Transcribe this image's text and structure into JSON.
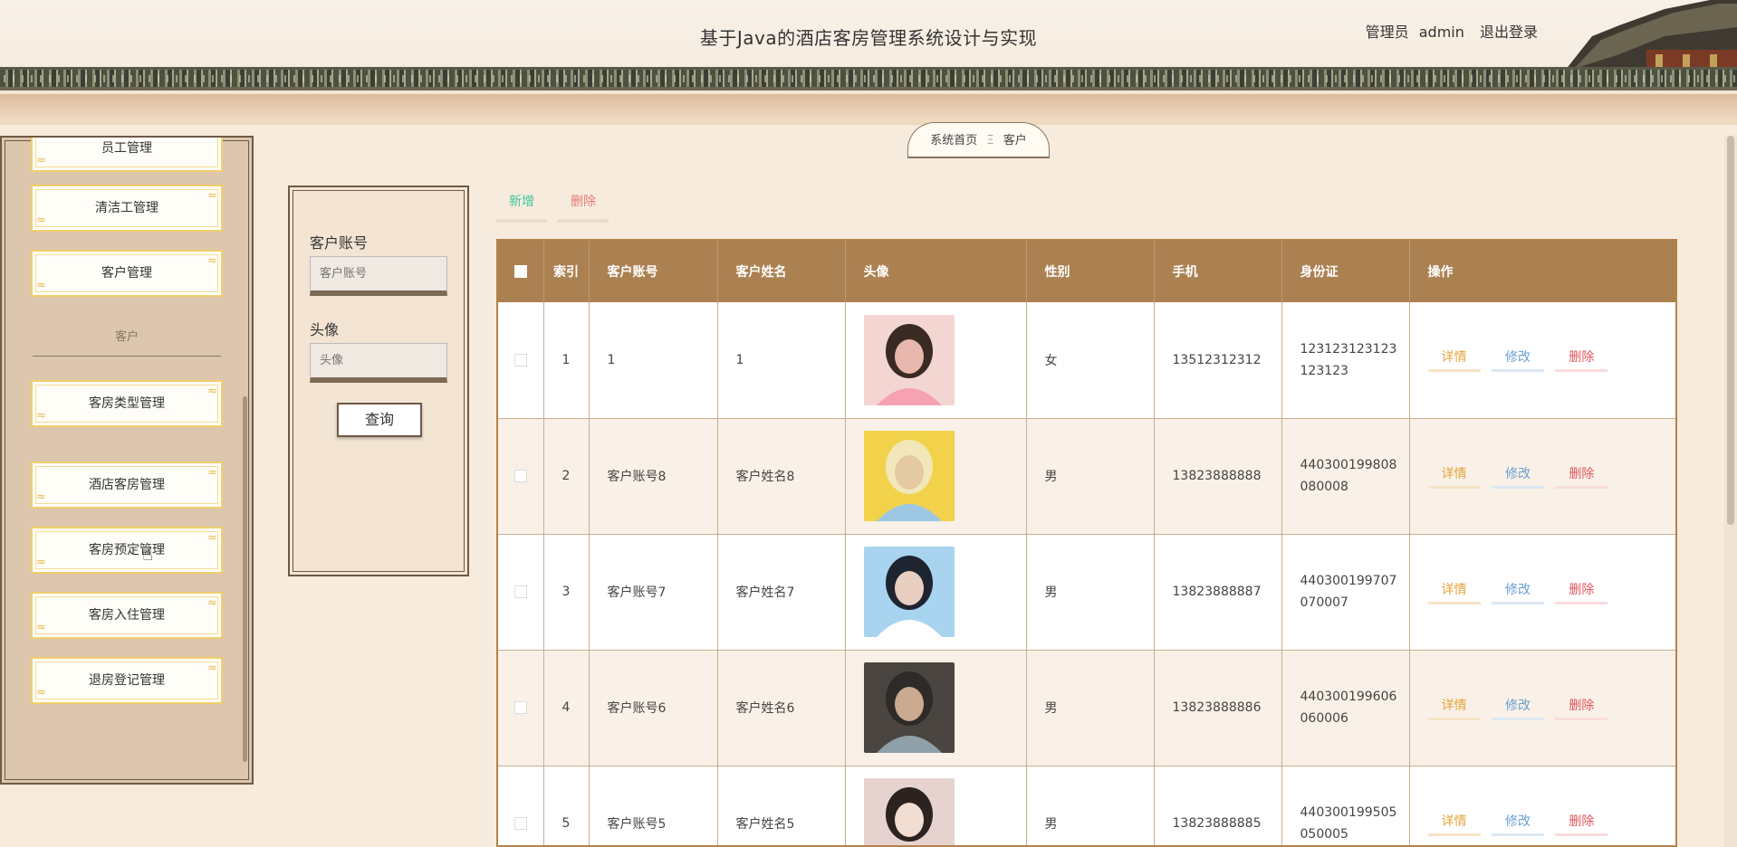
{
  "header": {
    "title": "基于Java的酒店客房管理系统设计与实现",
    "user_role": "管理员",
    "username": "admin",
    "logout": "退出登录"
  },
  "sidebar": {
    "items": [
      {
        "label": "员工管理"
      },
      {
        "label": "清洁工管理"
      },
      {
        "label": "客户管理"
      },
      {
        "label": "客房类型管理"
      },
      {
        "label": "酒店客房管理"
      },
      {
        "label": "客房预定管理"
      },
      {
        "label": "客房入住管理"
      },
      {
        "label": "退房登记管理"
      }
    ],
    "section_heading": "客户"
  },
  "breadcrumb": {
    "home": "系统首页",
    "separator": "Ξ",
    "current": "客户"
  },
  "search": {
    "account_label": "客户账号",
    "account_placeholder": "客户账号",
    "avatar_label": "头像",
    "avatar_placeholder": "头像",
    "query_button": "查询"
  },
  "toolbar": {
    "add": "新增",
    "delete": "删除"
  },
  "table": {
    "headers": {
      "index": "索引",
      "account": "客户账号",
      "name": "客户姓名",
      "avatar": "头像",
      "gender": "性别",
      "phone": "手机",
      "idcard": "身份证",
      "actions": "操作"
    },
    "actions": {
      "detail": "详情",
      "edit": "修改",
      "delete": "删除"
    },
    "rows": [
      {
        "index": "1",
        "account": "1",
        "name": "1",
        "gender": "女",
        "phone": "13512312312",
        "idcard": "123123123123123123"
      },
      {
        "index": "2",
        "account": "客户账号8",
        "name": "客户姓名8",
        "gender": "男",
        "phone": "13823888888",
        "idcard": "440300199808080008"
      },
      {
        "index": "3",
        "account": "客户账号7",
        "name": "客户姓名7",
        "gender": "男",
        "phone": "13823888887",
        "idcard": "440300199707070007"
      },
      {
        "index": "4",
        "account": "客户账号6",
        "name": "客户姓名6",
        "gender": "男",
        "phone": "13823888886",
        "idcard": "440300199606060006"
      },
      {
        "index": "5",
        "account": "客户账号5",
        "name": "客户姓名5",
        "gender": "男",
        "phone": "13823888885",
        "idcard": "440300199505050005"
      }
    ]
  },
  "colors": {
    "accent": "#ac8152",
    "add": "#3cc5a2",
    "delete": "#e5555d",
    "detail": "#e6a13b",
    "edit": "#6a9fd0"
  }
}
